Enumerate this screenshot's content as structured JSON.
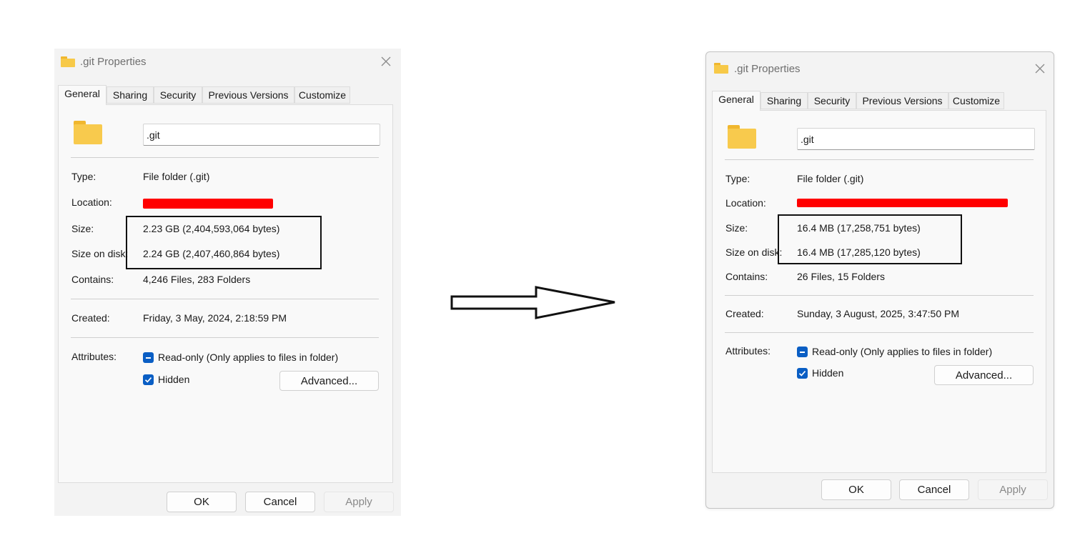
{
  "before": {
    "title": ".git Properties",
    "tabs": [
      "General",
      "Sharing",
      "Security",
      "Previous Versions",
      "Customize"
    ],
    "folder_name": ".git",
    "labels": {
      "type": "Type:",
      "location": "Location:",
      "size": "Size:",
      "size_on_disk": "Size on disk:",
      "contains": "Contains:",
      "created": "Created:",
      "attributes": "Attributes:"
    },
    "values": {
      "type": "File folder (.git)",
      "size": "2.23 GB (2,404,593,064 bytes)",
      "size_on_disk": "2.24 GB (2,407,460,864 bytes)",
      "contains": "4,246 Files, 283 Folders",
      "created": "Friday, 3 May, 2024, 2:18:59 PM"
    },
    "attributes": {
      "readonly_label": "Read-only (Only applies to files in folder)",
      "hidden_label": "Hidden",
      "advanced_button": "Advanced..."
    },
    "buttons": {
      "ok": "OK",
      "cancel": "Cancel",
      "apply": "Apply"
    }
  },
  "after": {
    "title": ".git Properties",
    "tabs": [
      "General",
      "Sharing",
      "Security",
      "Previous Versions",
      "Customize"
    ],
    "folder_name": ".git",
    "labels": {
      "type": "Type:",
      "location": "Location:",
      "size": "Size:",
      "size_on_disk": "Size on disk:",
      "contains": "Contains:",
      "created": "Created:",
      "attributes": "Attributes:"
    },
    "values": {
      "type": "File folder (.git)",
      "size": "16.4 MB (17,258,751 bytes)",
      "size_on_disk": "16.4 MB (17,285,120 bytes)",
      "contains": "26 Files, 15 Folders",
      "created": "Sunday, 3 August, 2025, 3:47:50 PM"
    },
    "attributes": {
      "readonly_label": "Read-only (Only applies to files in folder)",
      "hidden_label": "Hidden",
      "advanced_button": "Advanced..."
    },
    "buttons": {
      "ok": "OK",
      "cancel": "Cancel",
      "apply": "Apply"
    }
  },
  "icons": {
    "folder": "folder-icon",
    "close": "close-icon",
    "arrow": "right-arrow-icon",
    "checkbox_indeterminate": "checkbox-indeterminate-icon",
    "checkbox_checked": "checkbox-checked-icon"
  },
  "colors": {
    "accent": "#0a5ec4",
    "redaction": "#ff0000",
    "folder": "#f8ca4d",
    "highlight_border": "#111111"
  }
}
